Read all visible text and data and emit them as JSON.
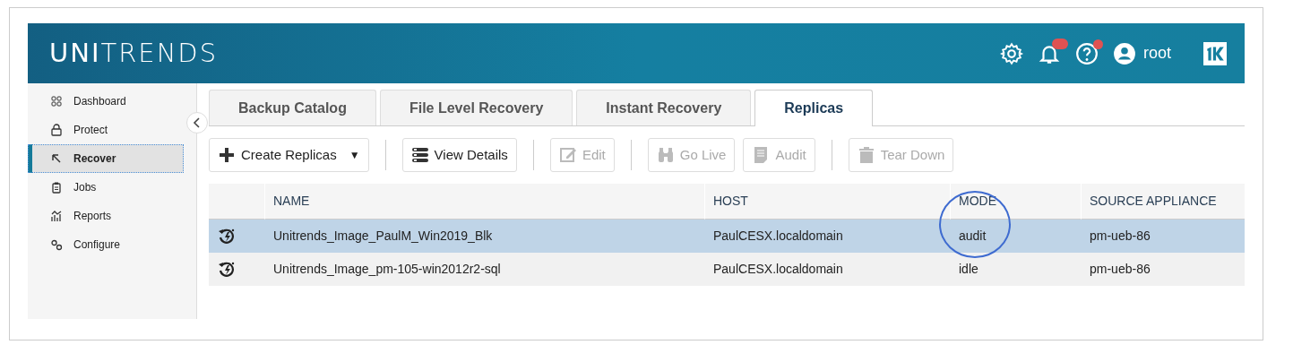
{
  "header": {
    "logo": "**UNI**TRENDS",
    "user": "root",
    "notification_dot": true,
    "help_dot": true
  },
  "sidebar": {
    "items": [
      {
        "label": "Dashboard",
        "selected": false
      },
      {
        "label": "Protect",
        "selected": false
      },
      {
        "label": "Recover",
        "selected": true
      },
      {
        "label": "Jobs",
        "selected": false
      },
      {
        "label": "Reports",
        "selected": false
      },
      {
        "label": "Configure",
        "selected": false
      }
    ]
  },
  "tabs": [
    {
      "label": "Backup Catalog",
      "selected": false
    },
    {
      "label": "File Level Recovery",
      "selected": false
    },
    {
      "label": "Instant Recovery",
      "selected": false
    },
    {
      "label": "Replicas",
      "selected": true
    }
  ],
  "toolbar": [
    {
      "label": "Create Replicas",
      "kind": "dropdown",
      "disabled": false,
      "caret": "▼"
    },
    {
      "label": "View Details",
      "kind": "button",
      "disabled": false
    },
    {
      "label": "Edit",
      "kind": "button",
      "disabled": true
    },
    {
      "label": "Go Live",
      "kind": "button",
      "disabled": true
    },
    {
      "label": "Audit",
      "kind": "button",
      "disabled": true
    },
    {
      "label": "Tear Down",
      "kind": "button",
      "disabled": true
    }
  ],
  "table": {
    "columns": [
      "NAME",
      "HOST",
      "MODE",
      "SOURCE APPLIANCE"
    ],
    "rows": [
      {
        "selected": true,
        "cells": [
          "Unitrends_Image_PaulM_Win2019_Blk",
          "PaulCESX.localdomain",
          "audit",
          "pm-ueb-86"
        ]
      },
      {
        "selected": false,
        "cells": [
          "Unitrends_Image_pm-105-win2012r2-sql",
          "PaulCESX.localdomain",
          "idle",
          "pm-ueb-86"
        ]
      }
    ]
  },
  "annotation": {
    "kind": "circle"
  }
}
